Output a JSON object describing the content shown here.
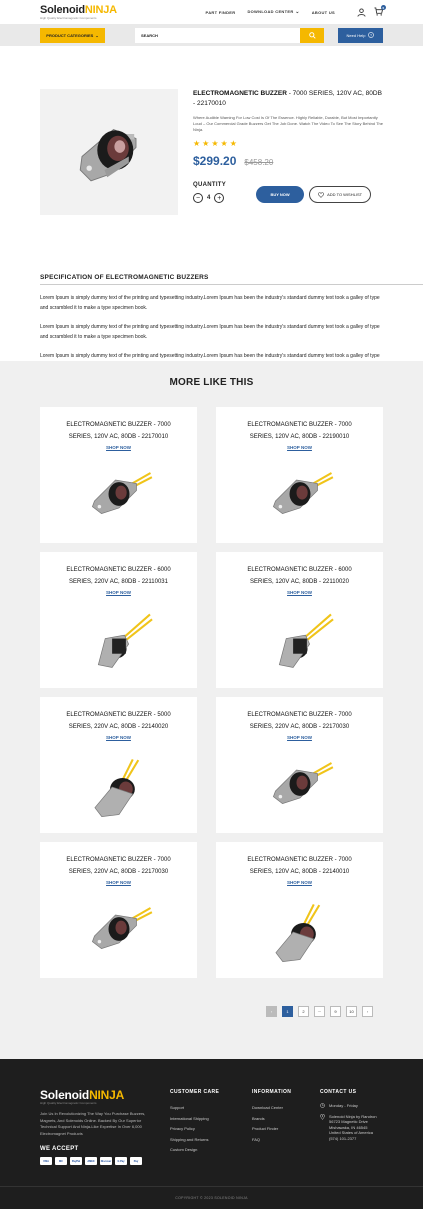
{
  "brand": {
    "name_part1": "Solenoid",
    "name_part2": "NINJA",
    "tagline": "High Quality Electromagnetic Components"
  },
  "colors": {
    "accent": "#f5b800",
    "primary": "#2d5f9e",
    "footer_bg": "#1e1e1e"
  },
  "nav": {
    "items": [
      "PART FINDER",
      "DOWNLOAD CENTER",
      "ABOUT US"
    ],
    "cart_count": "0"
  },
  "search": {
    "categories_label": "PRODUCT CATEGORIES",
    "placeholder": "SEARCH",
    "help_label": "Need Help"
  },
  "product": {
    "title_bold": "ELECTROMAGNETIC BUZZER",
    "title_rest": " - 7000 SERIES, 120V AC, 80DB - 22170010",
    "description": "Where Audible Warning For Low Cost Is Of The Essence. Highly Reliable, Durable, But Most Importantly Loud – Our Commercial Grade Buzzers Get The Job Done. Watch The Video To See The Story Behind The Ninja.",
    "rating": 5,
    "stars": "★★★★★",
    "price": "$299.20",
    "old_price": "$458.20",
    "quantity_label": "QUANTITY",
    "quantity": "4",
    "buy_label": "BUY NOW",
    "wishlist_label": "ADD TO WISHLIST"
  },
  "spec": {
    "title": "SPECIFICATION OF ELECTROMAGNETIC BUZZERS",
    "paragraphs": [
      "Lorem Ipsum is simply dummy text of the printing and typesetting industry.Lorem Ipsum has been the industry's standard dummy text took a galley of type and scrambled it to make a type specimen book.",
      "Lorem Ipsum is simply dummy text of the printing and typesetting industry.Lorem Ipsum has been the industry's standard dummy text took a galley of type and scrambled it to make a type specimen book.",
      "Lorem Ipsum is simply dummy text of the printing and typesetting industry.Lorem Ipsum has been the industry's standard dummy text took a galley of type and scrambled it to make a type specimen book."
    ]
  },
  "more": {
    "title": "MORE LIKE THIS",
    "shop_label": "SHOP NOW",
    "products": [
      {
        "line1": "ELECTROMAGNETIC BUZZER - 7000",
        "line2": "SERIES, 120V AC, 80DB - 22170010"
      },
      {
        "line1": "ELECTROMAGNETIC BUZZER - 7000",
        "line2": "SERIES, 120V AC, 80DB - 22190010"
      },
      {
        "line1": "ELECTROMAGNETIC BUZZER - 6000",
        "line2": "SERIES, 220V AC, 80DB - 22110031"
      },
      {
        "line1": "ELECTROMAGNETIC BUZZER - 6000",
        "line2": "SERIES, 120V AC, 80DB - 22110020"
      },
      {
        "line1": "ELECTROMAGNETIC BUZZER - 5000",
        "line2": "SERIES, 220V AC, 80DB - 22140020"
      },
      {
        "line1": "ELECTROMAGNETIC BUZZER - 7000",
        "line2": "SERIES, 220V AC, 80DB - 22170030"
      },
      {
        "line1": "ELECTROMAGNETIC BUZZER - 7000",
        "line2": "SERIES, 220V AC, 80DB - 22170030"
      },
      {
        "line1": "ELECTROMAGNETIC BUZZER - 7000",
        "line2": "SERIES, 120V AC, 80DB - 22140010"
      }
    ]
  },
  "pagination": {
    "prev": "‹",
    "pages": [
      "1",
      "2",
      "···",
      "9",
      "10"
    ],
    "next": "›",
    "current": "1"
  },
  "footer": {
    "about": "Join Us In Revolutionizing The Way You Purchase Buzzers, Magnets, And Solenoids Online. Backed By Our Superior Technical Support And Ninja-Like Expertise In Over 6,000 Electromagnet Products",
    "accept_title": "WE ACCEPT",
    "payment_methods": [
      "VISA",
      "MC",
      "PayPal",
      "AMEX",
      "Discover",
      "G Pay",
      "Pay"
    ],
    "customer_care": {
      "title": "CUSTOMER CARE",
      "items": [
        "Support",
        "International Shipping",
        "Privacy Policy",
        "Shipping and Returns",
        "Custom Design"
      ]
    },
    "information": {
      "title": "INFORMATION",
      "items": [
        "Download Center",
        "Brands",
        "Product Finder",
        "FAQ"
      ]
    },
    "contact": {
      "title": "CONTACT US",
      "hours": "Monday - Friday",
      "address": [
        "Solenoid Ninja by Randron",
        "56723 Magnetic Drive",
        "Mishawaka, IN 46545",
        "United States of America",
        "(574) 101-2377"
      ]
    },
    "copyright": "COPYRIGHT © 2023 SOLENOID NINJA"
  }
}
